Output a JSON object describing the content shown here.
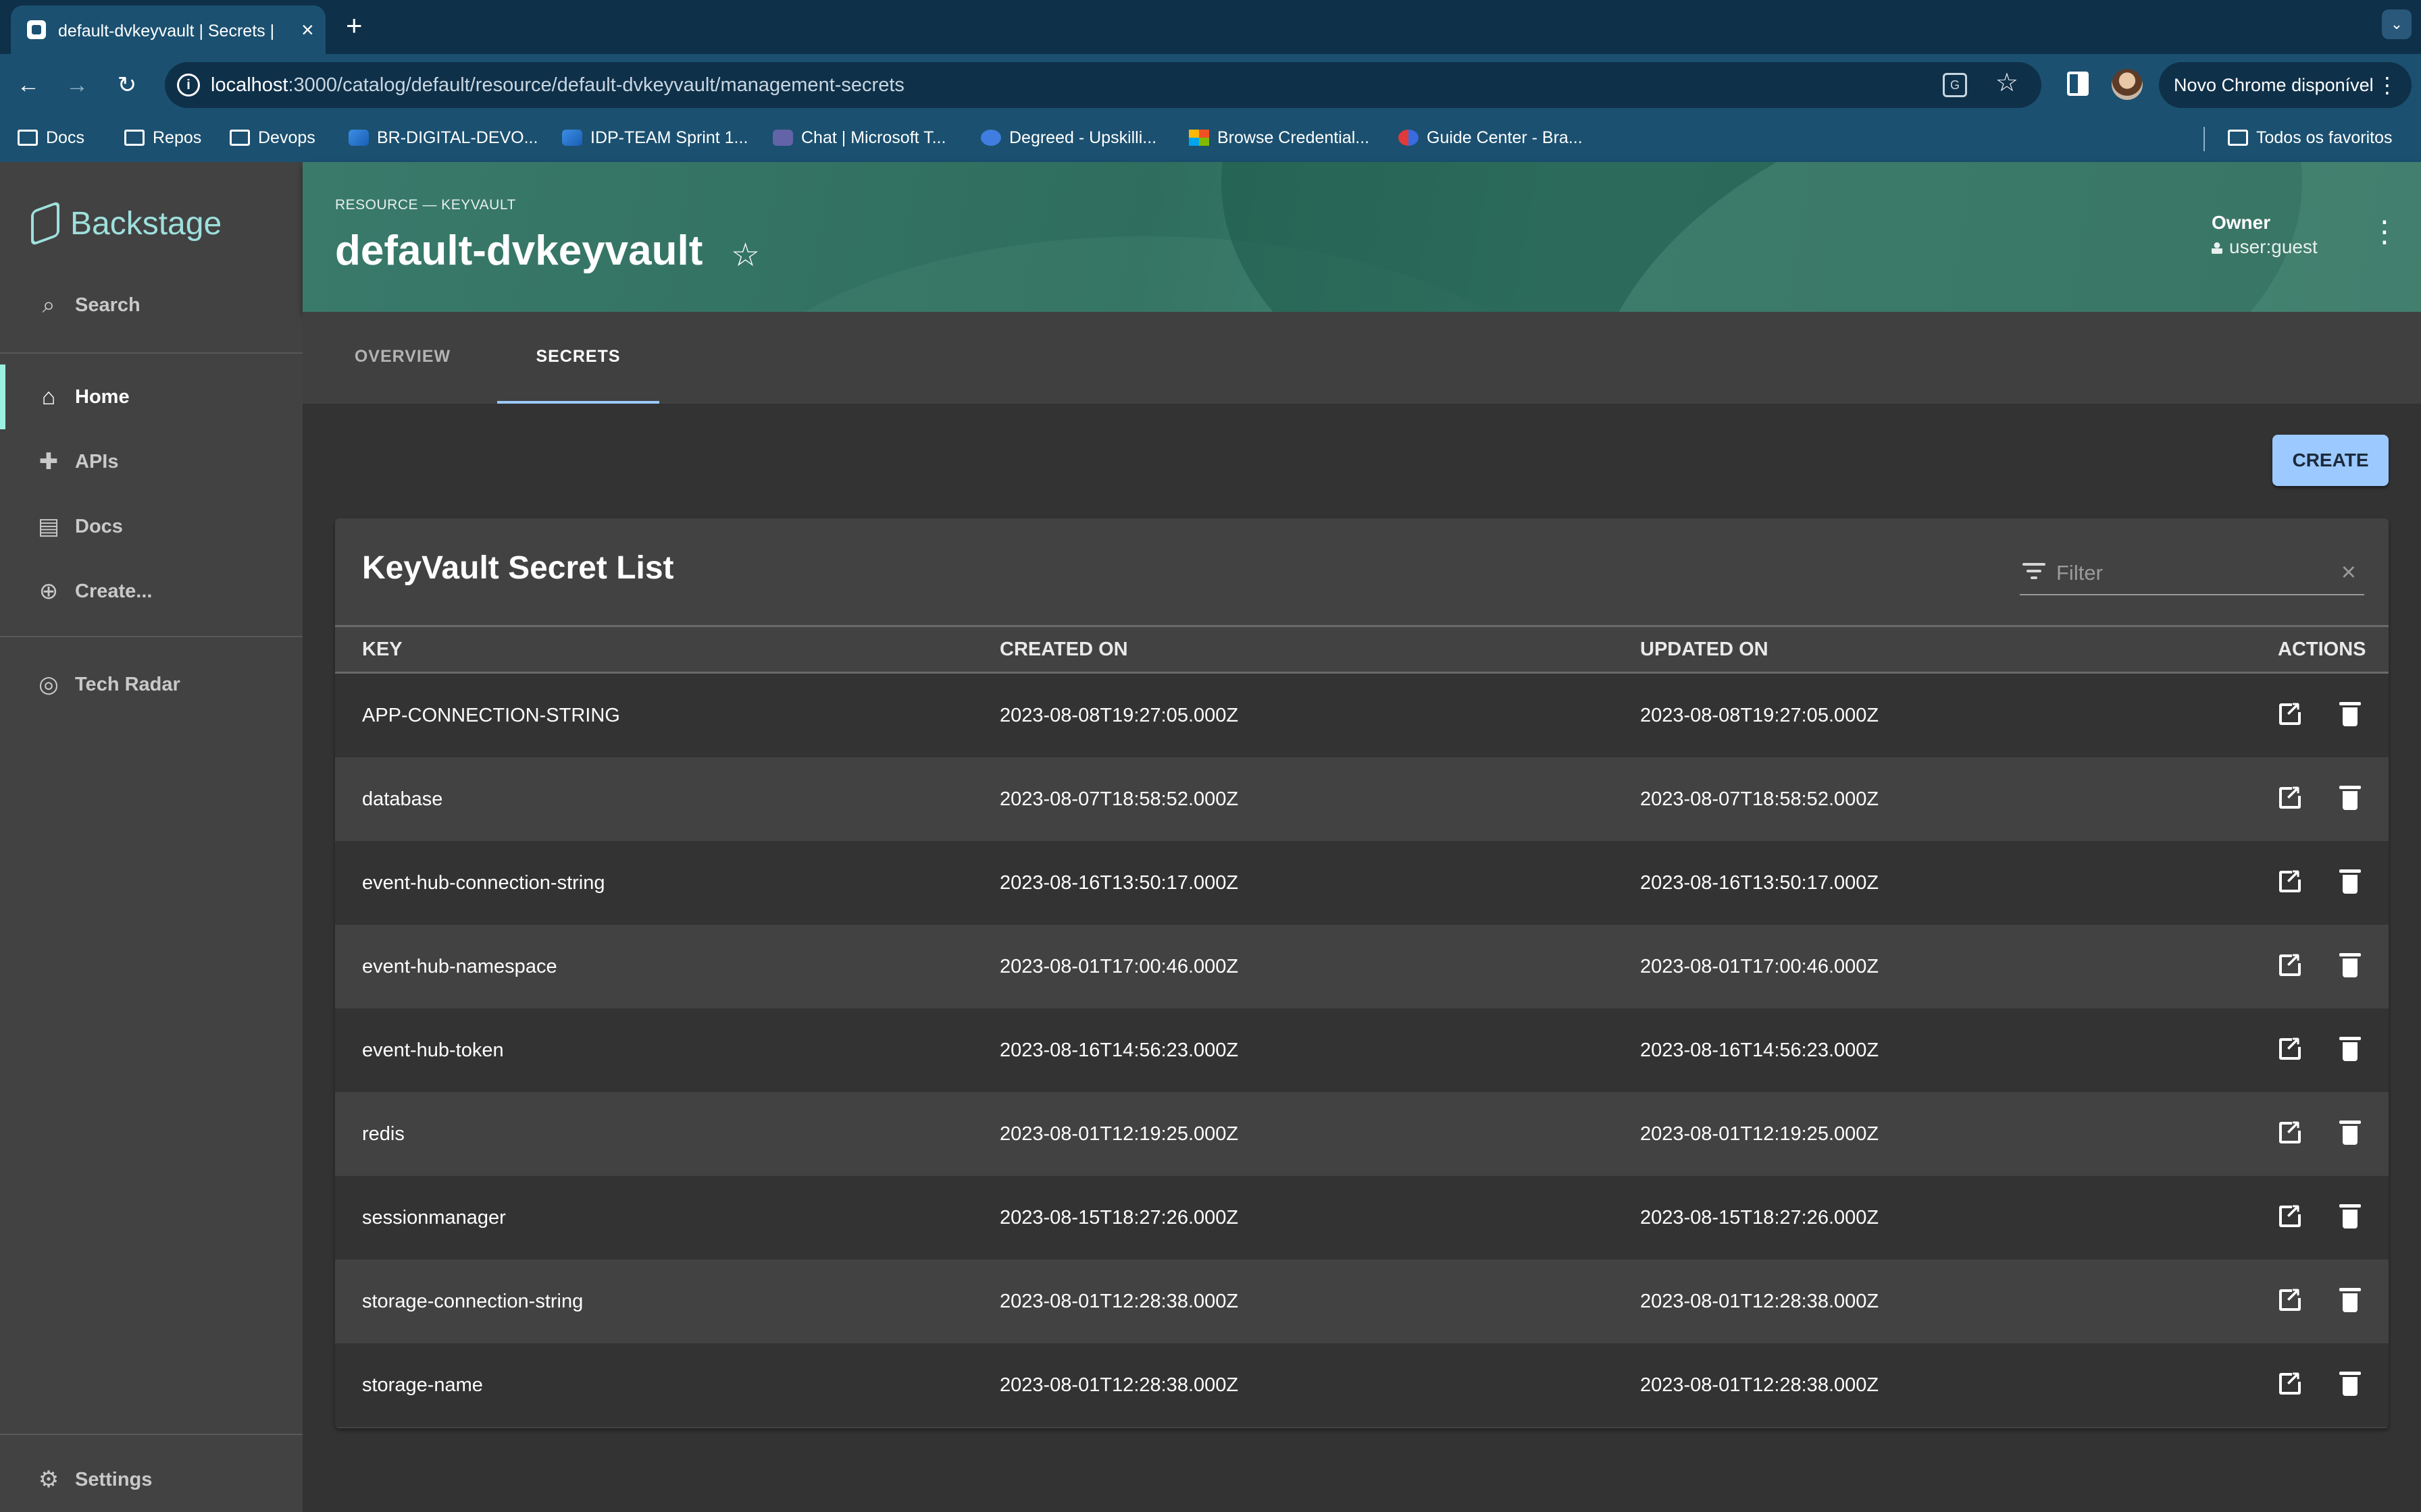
{
  "browser": {
    "tab_title": "default-dvkeyvault | Secrets |",
    "url_host": "localhost",
    "url_rest": ":3000/catalog/default/resource/default-dvkeyvault/management-secrets",
    "update_chip": "Novo Chrome disponível",
    "bookmarks": [
      {
        "label": "Docs",
        "icon": "folder-icon"
      },
      {
        "label": "Repos",
        "icon": "folder-icon"
      },
      {
        "label": "Devops",
        "icon": "folder-icon"
      },
      {
        "label": "BR-DIGITAL-DEVO...",
        "icon": "azure-devops-icon"
      },
      {
        "label": "IDP-TEAM Sprint 1...",
        "icon": "azure-devops-icon"
      },
      {
        "label": "Chat | Microsoft T...",
        "icon": "teams-icon"
      },
      {
        "label": "Degreed - Upskilli...",
        "icon": "degreed-icon"
      },
      {
        "label": "Browse Credential...",
        "icon": "microsoft-icon"
      },
      {
        "label": "Guide Center - Bra...",
        "icon": "guide-icon"
      }
    ],
    "all_bookmarks": "Todos os favoritos"
  },
  "sidebar": {
    "brand": "Backstage",
    "search": "Search",
    "items": [
      {
        "label": "Home",
        "icon": "home-icon"
      },
      {
        "label": "APIs",
        "icon": "puzzle-icon"
      },
      {
        "label": "Docs",
        "icon": "library-icon"
      },
      {
        "label": "Create...",
        "icon": "add-circle-icon"
      }
    ],
    "tech_radar": "Tech Radar",
    "settings": "Settings"
  },
  "header": {
    "breadcrumb": "RESOURCE — KEYVAULT",
    "title": "default-dvkeyvault",
    "owner_label": "Owner",
    "owner_value": "user:guest"
  },
  "tabs": [
    "OVERVIEW",
    "SECRETS"
  ],
  "actions": {
    "create": "CREATE"
  },
  "table": {
    "title": "KeyVault Secret List",
    "filter_placeholder": "Filter",
    "columns": [
      "KEY",
      "CREATED ON",
      "UPDATED ON",
      "ACTIONS"
    ],
    "rows": [
      {
        "key": "APP-CONNECTION-STRING",
        "created": "2023-08-08T19:27:05.000Z",
        "updated": "2023-08-08T19:27:05.000Z"
      },
      {
        "key": "database",
        "created": "2023-08-07T18:58:52.000Z",
        "updated": "2023-08-07T18:58:52.000Z"
      },
      {
        "key": "event-hub-connection-string",
        "created": "2023-08-16T13:50:17.000Z",
        "updated": "2023-08-16T13:50:17.000Z"
      },
      {
        "key": "event-hub-namespace",
        "created": "2023-08-01T17:00:46.000Z",
        "updated": "2023-08-01T17:00:46.000Z"
      },
      {
        "key": "event-hub-token",
        "created": "2023-08-16T14:56:23.000Z",
        "updated": "2023-08-16T14:56:23.000Z"
      },
      {
        "key": "redis",
        "created": "2023-08-01T12:19:25.000Z",
        "updated": "2023-08-01T12:19:25.000Z"
      },
      {
        "key": "sessionmanager",
        "created": "2023-08-15T18:27:26.000Z",
        "updated": "2023-08-15T18:27:26.000Z"
      },
      {
        "key": "storage-connection-string",
        "created": "2023-08-01T12:28:38.000Z",
        "updated": "2023-08-01T12:28:38.000Z"
      },
      {
        "key": "storage-name",
        "created": "2023-08-01T12:28:38.000Z",
        "updated": "2023-08-01T12:28:38.000Z"
      }
    ]
  },
  "colors": {
    "accent": "#9cc9ff",
    "header": "#3a7a6b",
    "sidebar": "#424242",
    "active_marker": "#9bf0e1"
  }
}
